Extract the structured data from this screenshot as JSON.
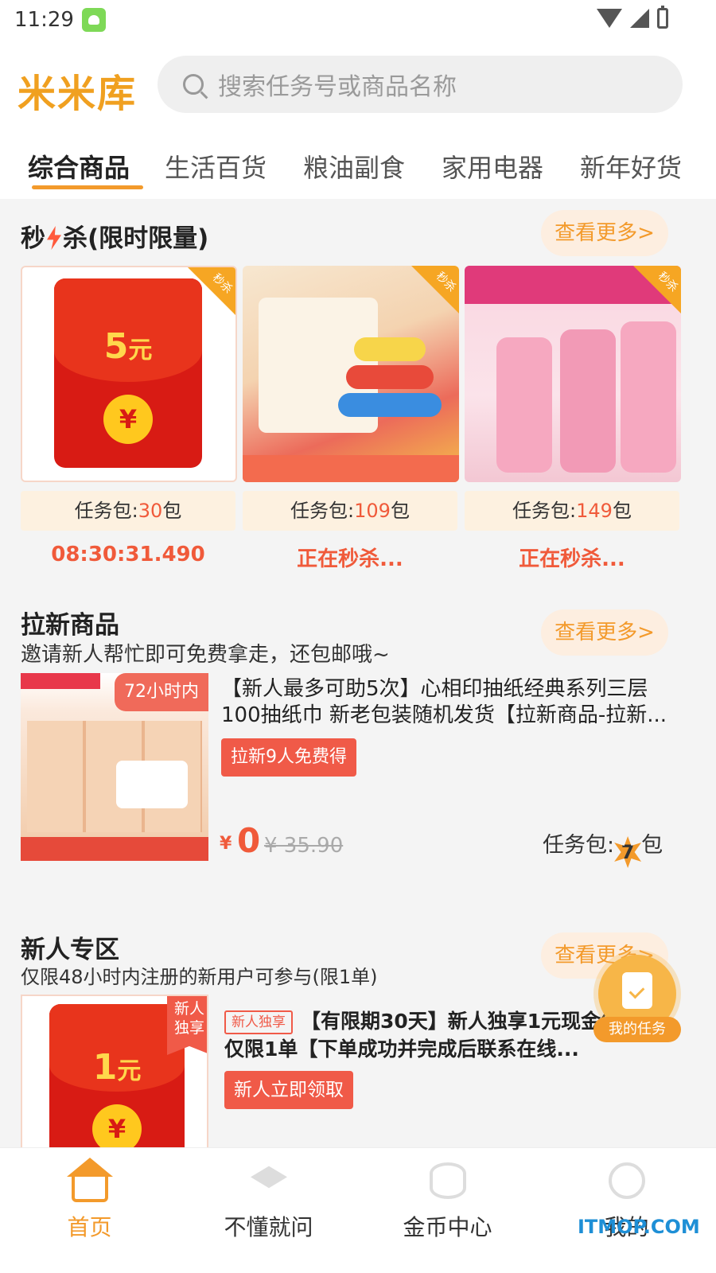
{
  "status": {
    "time": "11:29"
  },
  "header": {
    "logo": "米米库",
    "search_placeholder": "搜索任务号或商品名称"
  },
  "tabs": [
    "综合商品",
    "生活百货",
    "粮油副食",
    "家用电器",
    "新年好货"
  ],
  "flash": {
    "title_a": "秒",
    "title_b": "杀(限时限量)",
    "more": "查看更多>",
    "items": [
      {
        "amount": "5",
        "unit": "元",
        "yuan": "¥",
        "corner": "秒杀",
        "pack_label": "任务包:",
        "pack_num": "30",
        "pack_unit": "包",
        "status": "08:30:31.490"
      },
      {
        "corner": "秒杀",
        "pack_label": "任务包:",
        "pack_num": "109",
        "pack_unit": "包",
        "status": "正在秒杀..."
      },
      {
        "corner": "秒杀",
        "pack_label": "任务包:",
        "pack_num": "149",
        "pack_unit": "包",
        "status": "正在秒杀..."
      }
    ]
  },
  "laxin": {
    "title": "拉新商品",
    "subtitle": "邀请新人帮忙即可免费拿走，还包邮哦~",
    "more": "查看更多>",
    "product": {
      "badge": "72小时内",
      "title": "【新人最多可助5次】心相印抽纸经典系列三层100抽纸巾 新老包装随机发货【拉新商品-拉新...",
      "tag": "拉新9人免费得",
      "currency": "¥",
      "price": "0",
      "old_price": "¥ 35.90",
      "pack_label": "任务包:",
      "pack_num": "7",
      "pack_unit": "包"
    }
  },
  "newuser": {
    "title": "新人专区",
    "subtitle": "仅限48小时内注册的新用户可参与(限1单)",
    "more": "查看更多>",
    "product": {
      "badge": "新人独享",
      "amount": "1",
      "unit": "元",
      "yuan": "¥",
      "inline_tag": "新人独享",
      "title": "【有限期30天】新人独享1元现金红包，仅限1单【下单成功并完成后联系在线...",
      "button": "新人立即领取"
    }
  },
  "float_task": {
    "label": "我的任务"
  },
  "nav": [
    "首页",
    "不懂就问",
    "金币中心",
    "我的"
  ],
  "watermark": "ITMOP.COM"
}
